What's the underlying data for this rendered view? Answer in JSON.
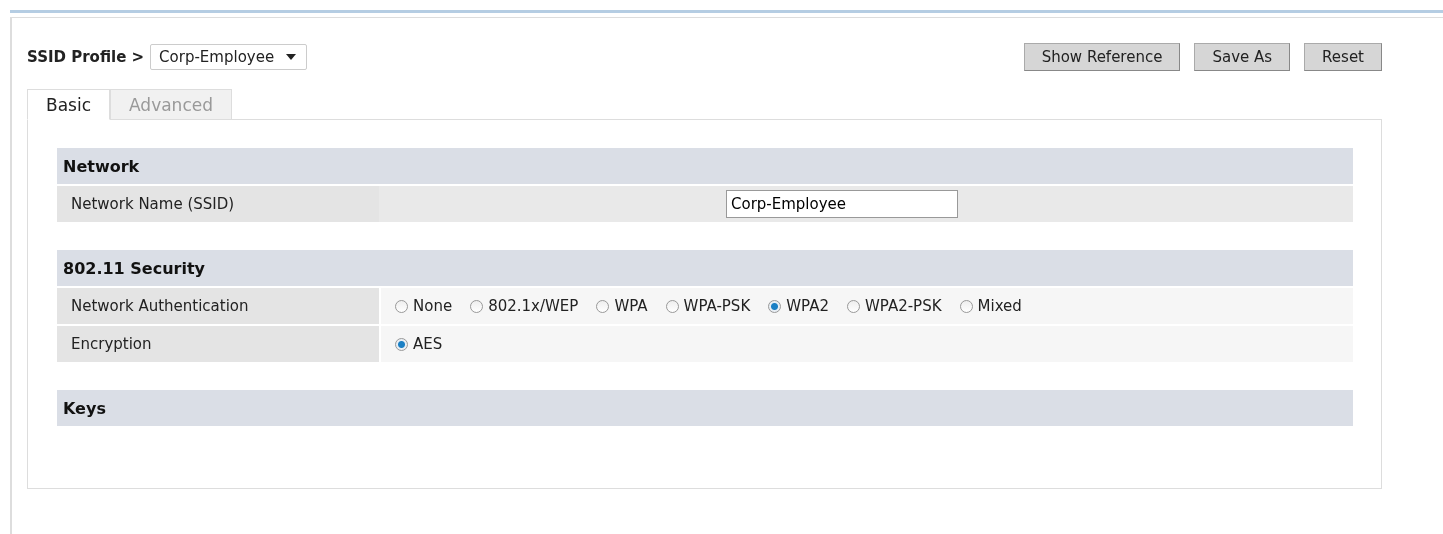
{
  "profile": {
    "label": "SSID Profile >",
    "value": "Corp-Employee"
  },
  "buttons": [
    "Show Reference",
    "Save As",
    "Reset"
  ],
  "tabs": [
    {
      "label": "Basic",
      "selected": true
    },
    {
      "label": "Advanced",
      "selected": false
    }
  ],
  "sections": [
    {
      "title": "Network",
      "rows": [
        {
          "label": "Network Name (SSID)",
          "kind": "text",
          "value": "Corp-Employee"
        }
      ]
    },
    {
      "title": "802.11 Security",
      "rows": [
        {
          "label": "Network Authentication",
          "kind": "radio",
          "options": [
            {
              "label": "None",
              "selected": false
            },
            {
              "label": "802.1x/WEP",
              "selected": false
            },
            {
              "label": "WPA",
              "selected": false
            },
            {
              "label": "WPA-PSK",
              "selected": false
            },
            {
              "label": "WPA2",
              "selected": true
            },
            {
              "label": "WPA2-PSK",
              "selected": false
            },
            {
              "label": "Mixed",
              "selected": false
            }
          ]
        },
        {
          "label": "Encryption",
          "kind": "radio",
          "options": [
            {
              "label": "AES",
              "selected": true
            }
          ]
        }
      ]
    },
    {
      "title": "Keys"
    }
  ]
}
